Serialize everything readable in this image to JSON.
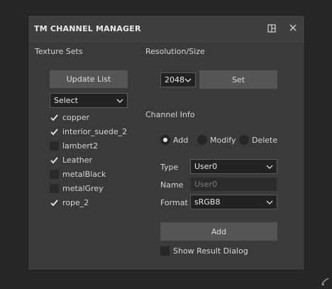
{
  "window": {
    "title": "TM CHANNEL MANAGER",
    "layout_icon": "layout-icon",
    "close_icon": "close-icon"
  },
  "texture_sets": {
    "label": "Texture Sets",
    "update_button": "Update List",
    "select": {
      "value": "Select"
    },
    "items": [
      {
        "label": "copper",
        "checked": true
      },
      {
        "label": "interior_suede_2",
        "checked": true
      },
      {
        "label": "lambert2",
        "checked": false
      },
      {
        "label": "Leather",
        "checked": true
      },
      {
        "label": "metalBlack",
        "checked": false
      },
      {
        "label": "metalGrey",
        "checked": false
      },
      {
        "label": "rope_2",
        "checked": true
      }
    ]
  },
  "resolution": {
    "label": "Resolution/Size",
    "value": "2048",
    "set_button": "Set"
  },
  "channel_info": {
    "label": "Channel Info",
    "modes": [
      {
        "label": "Add",
        "selected": true
      },
      {
        "label": "Modify",
        "selected": false
      },
      {
        "label": "Delete",
        "selected": false
      }
    ],
    "type_label": "Type",
    "type_value": "User0",
    "name_label": "Name",
    "name_placeholder": "User0",
    "format_label": "Format",
    "format_value": "sRGB8",
    "add_button": "Add",
    "show_result_label": "Show Result Dialog",
    "show_result_checked": false
  },
  "colors": {
    "panel_bg": "#3a3a3a",
    "button_bg": "#555555",
    "field_bg": "#222222"
  }
}
